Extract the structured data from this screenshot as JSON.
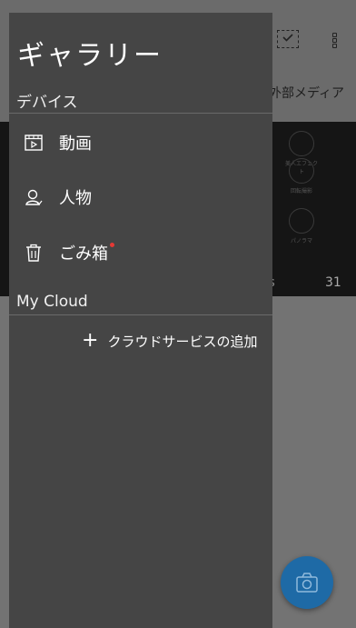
{
  "drawer": {
    "title": "ギャラリー",
    "section_devices": "デバイス",
    "items": [
      {
        "label": "動画",
        "icon": "video-icon"
      },
      {
        "label": "人物",
        "icon": "person-icon"
      },
      {
        "label": "ごみ箱",
        "icon": "trash-icon",
        "has_badge": true
      }
    ],
    "section_cloud": "My Cloud",
    "add_cloud_label": "クラウドサービスの追加",
    "add_cloud_icon": "plus-icon"
  },
  "background_app": {
    "tab_label": "外部メディア",
    "count_partial": "ts",
    "count": "31",
    "tools": [
      "美人エフェクト",
      "回転撮影",
      "パノラマ"
    ]
  },
  "colors": {
    "drawer_bg": "#454545",
    "fab": "#1e6aa6",
    "badge": "#e53935"
  }
}
